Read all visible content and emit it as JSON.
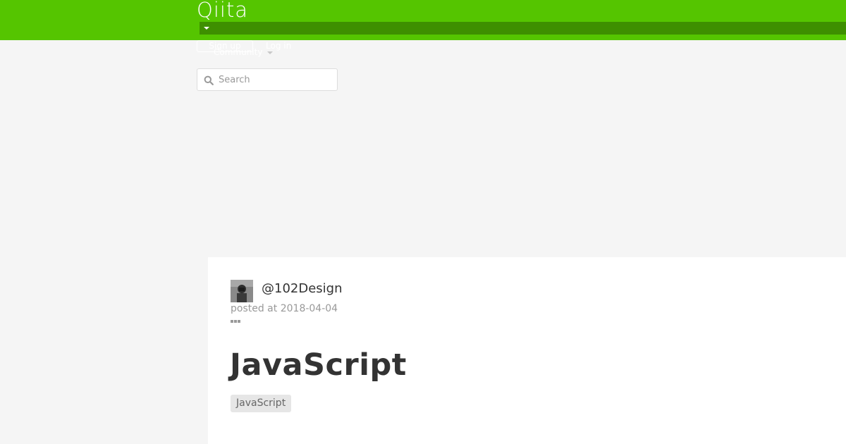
{
  "header": {
    "logo_text": "Qiita",
    "brand_color": "#55c500",
    "subbar_color": "#3e8f00",
    "subbar_icon": "caret-down-icon"
  },
  "auth": {
    "signup_label": "Sign up",
    "login_label": "Log in"
  },
  "community": {
    "label": "Community",
    "icon": "caret-down-icon"
  },
  "search": {
    "placeholder": "Search",
    "value": "",
    "icon": "search-icon"
  },
  "article": {
    "author": "@102Design",
    "posted_prefix": "posted at",
    "posted_date": "2018-04-04",
    "menu_icon": "more-dots-icon",
    "title": "JavaScript",
    "tags": [
      "JavaScript"
    ]
  }
}
